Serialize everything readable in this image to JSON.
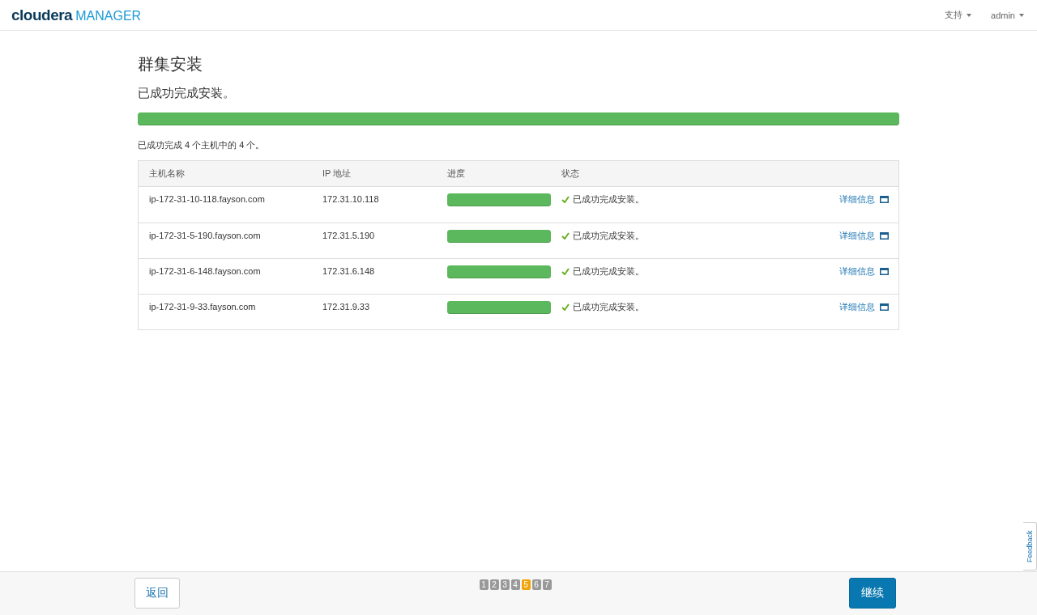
{
  "header": {
    "logo": {
      "brand": "cloudera",
      "product": "MANAGER"
    },
    "menus": [
      {
        "label": "支持"
      },
      {
        "label": "admin"
      }
    ]
  },
  "title": "群集安装",
  "subtitle": "已成功完成安装。",
  "overall_progress": {
    "level": 1
  },
  "summary": "已成功完成 4 个主机中的 4 个。",
  "table": {
    "columns": [
      "主机名称",
      "IP 地址",
      "进度",
      "状态"
    ],
    "rows": [
      {
        "host": "ip-172-31-10-118.fayson.com",
        "ip": "172.31.10.118",
        "level": 1,
        "status": "已成功完成安装。",
        "success": true,
        "link": "详细信息"
      },
      {
        "host": "ip-172-31-5-190.fayson.com",
        "ip": "172.31.5.190",
        "level": 1,
        "status": "已成功完成安装。",
        "success": true,
        "link": "详细信息"
      },
      {
        "host": "ip-172-31-6-148.fayson.com",
        "ip": "172.31.6.148",
        "level": 1,
        "status": "已成功完成安装。",
        "success": true,
        "link": "详细信息"
      },
      {
        "host": "ip-172-31-9-33.fayson.com",
        "ip": "172.31.9.33",
        "level": 1,
        "status": "已成功完成安装。",
        "success": true,
        "link": "详细信息"
      }
    ]
  },
  "footer": {
    "back": "返回",
    "steps": [
      {
        "label": "1",
        "selected": false
      },
      {
        "label": "2",
        "selected": false
      },
      {
        "label": "3",
        "selected": false
      },
      {
        "label": "4",
        "selected": false
      },
      {
        "label": "5",
        "selected": true
      },
      {
        "label": "6",
        "selected": false
      },
      {
        "label": "7",
        "selected": false
      }
    ],
    "next": "继续"
  },
  "feedback": "Feedback"
}
